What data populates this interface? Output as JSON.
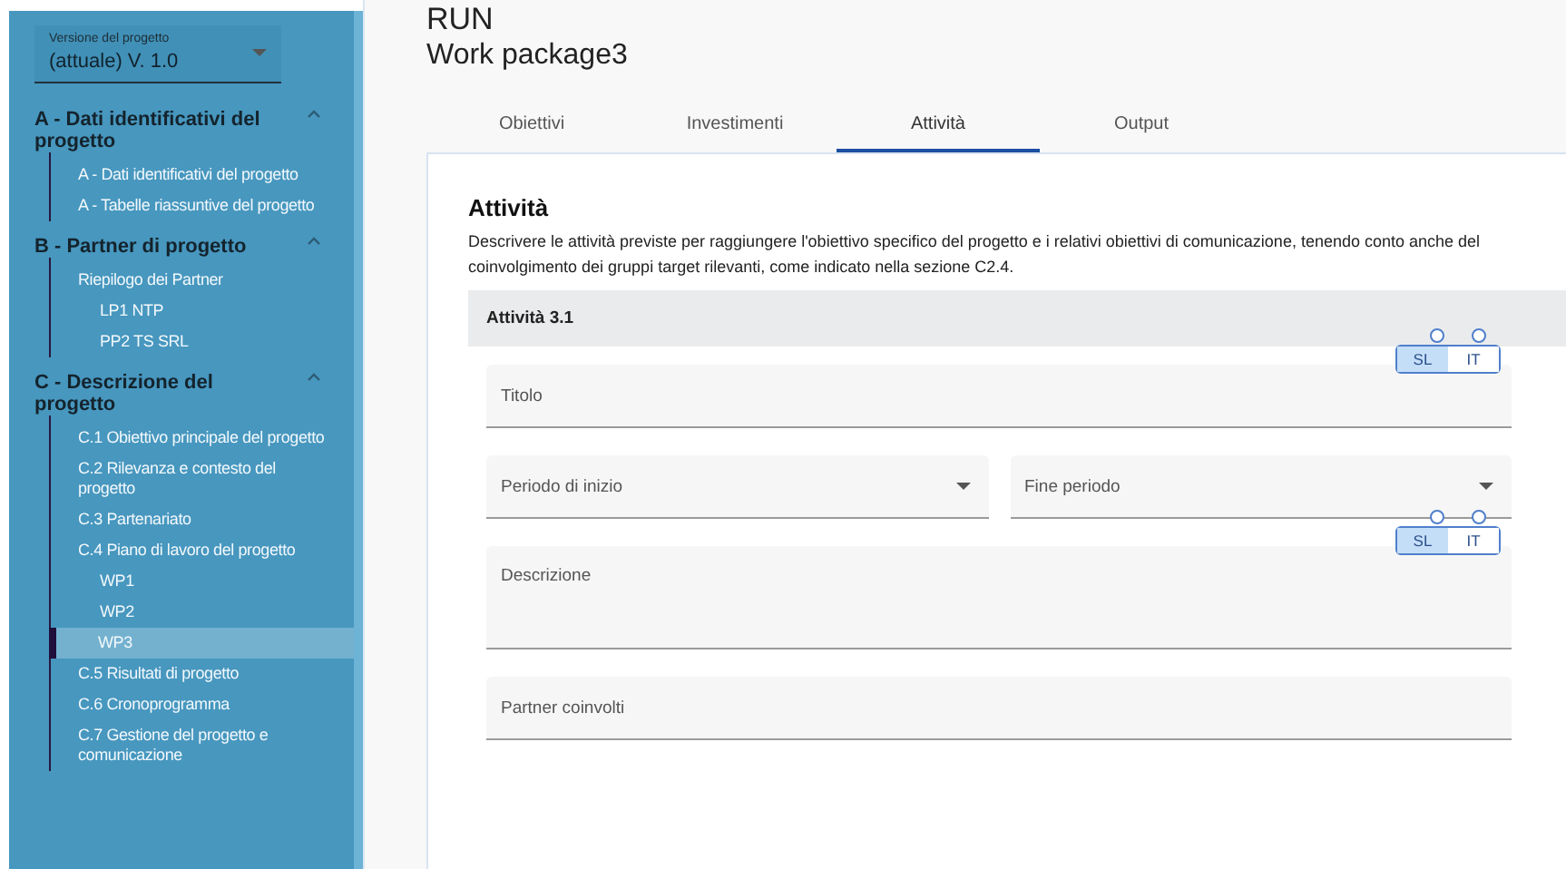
{
  "sidebar": {
    "version_select": {
      "label": "Versione del progetto",
      "value": "(attuale) V. 1.0"
    },
    "sections": [
      {
        "title": "A - Dati identificativi del progetto",
        "expanded": true,
        "items": [
          {
            "label": "A - Dati identificativi del progetto",
            "selected": false
          },
          {
            "label": "A - Tabelle riassuntive del progetto",
            "selected": false
          }
        ]
      },
      {
        "title": "B - Partner di progetto",
        "expanded": true,
        "items": [
          {
            "label": "Riepilogo dei Partner",
            "selected": false,
            "children": [
              {
                "label": "LP1 NTP",
                "selected": false
              },
              {
                "label": "PP2 TS SRL",
                "selected": false
              }
            ]
          }
        ]
      },
      {
        "title": "C - Descrizione del progetto",
        "expanded": true,
        "items": [
          {
            "label": "C.1 Obiettivo principale del progetto",
            "selected": false
          },
          {
            "label": "C.2 Rilevanza e contesto del progetto",
            "selected": false
          },
          {
            "label": "C.3 Partenariato",
            "selected": false
          },
          {
            "label": "C.4 Piano di lavoro del progetto",
            "selected": false,
            "children": [
              {
                "label": "WP1",
                "selected": false
              },
              {
                "label": "WP2",
                "selected": false
              },
              {
                "label": "WP3",
                "selected": true
              }
            ]
          },
          {
            "label": "C.5 Risultati di progetto",
            "selected": false
          },
          {
            "label": "C.6 Cronoprogramma",
            "selected": false
          },
          {
            "label": "C.7 Gestione del progetto e comunicazione",
            "selected": false
          }
        ]
      }
    ]
  },
  "header": {
    "title": "RUN",
    "subtitle": "Work package3"
  },
  "tabs": [
    {
      "label": "Obiettivi",
      "selected": false
    },
    {
      "label": "Investimenti",
      "selected": false
    },
    {
      "label": "Attività",
      "selected": true
    },
    {
      "label": "Output",
      "selected": false
    }
  ],
  "panel": {
    "title": "Attività",
    "description": "Descrivere le attività previste per raggiungere l'obiettivo specifico del progetto e i relativi obiettivi di comunicazione, tenendo conto anche del coinvolgimento dei gruppi target rilevanti, come indicato nella sezione C2.4.",
    "activity": {
      "title": "Attività 3.1",
      "rows": [
        [
          {
            "kind": "text",
            "label": "Titolo",
            "languages": [
              {
                "label": "SL",
                "selected": true
              },
              {
                "label": "IT",
                "selected": false
              }
            ]
          }
        ],
        [
          {
            "kind": "select",
            "label": "Periodo di inizio"
          },
          {
            "kind": "select",
            "label": "Fine periodo"
          }
        ],
        [
          {
            "kind": "textarea",
            "label": "Descrizione",
            "languages": [
              {
                "label": "SL",
                "selected": true
              },
              {
                "label": "IT",
                "selected": false
              }
            ]
          }
        ],
        [
          {
            "kind": "text",
            "label": "Partner coinvolti"
          }
        ]
      ]
    }
  }
}
